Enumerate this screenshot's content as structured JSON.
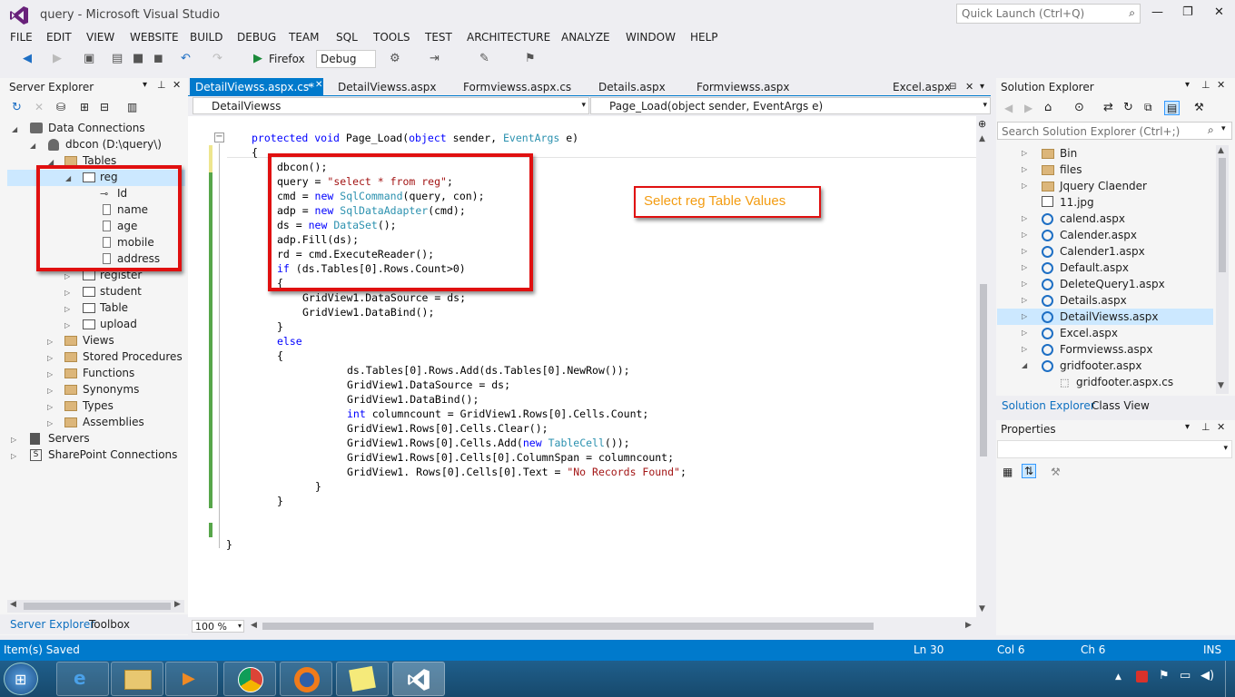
{
  "window": {
    "title": "query - Microsoft Visual Studio",
    "quick_launch_placeholder": "Quick Launch (Ctrl+Q)",
    "minimize": "—",
    "restore": "❐",
    "close": "✕"
  },
  "menu": [
    "FILE",
    "EDIT",
    "VIEW",
    "WEBSITE",
    "BUILD",
    "DEBUG",
    "TEAM",
    "SQL",
    "TOOLS",
    "TEST",
    "ARCHITECTURE",
    "ANALYZE",
    "WINDOW",
    "HELP"
  ],
  "toolbar": {
    "browser": "Firefox",
    "config": "Debug"
  },
  "server_explorer": {
    "title": "Server Explorer",
    "tree": [
      {
        "label": "Data Connections"
      },
      {
        "label": "dbcon (D:\\query\\)"
      },
      {
        "label": "Tables"
      },
      {
        "label": "reg"
      },
      {
        "label": "Id"
      },
      {
        "label": "name"
      },
      {
        "label": "age"
      },
      {
        "label": "mobile"
      },
      {
        "label": "address"
      },
      {
        "label": "register"
      },
      {
        "label": "student"
      },
      {
        "label": "Table"
      },
      {
        "label": "upload"
      },
      {
        "label": "Views"
      },
      {
        "label": "Stored Procedures"
      },
      {
        "label": "Functions"
      },
      {
        "label": "Synonyms"
      },
      {
        "label": "Types"
      },
      {
        "label": "Assemblies"
      },
      {
        "label": "Servers"
      },
      {
        "label": "SharePoint Connections"
      }
    ],
    "tabs": [
      "Server Explorer",
      "Toolbox"
    ]
  },
  "editor": {
    "tabs": [
      "DetailViewss.aspx.cs*",
      "DetailViewss.aspx",
      "Formviewss.aspx.cs",
      "Details.aspx",
      "Formviewss.aspx",
      "Excel.aspx"
    ],
    "nav_left": "DetailViewss",
    "nav_right": "Page_Load(object sender, EventArgs e)",
    "zoom": "100 %",
    "callout": "Select  reg Table Values"
  },
  "solution_explorer": {
    "title": "Solution Explorer",
    "search_placeholder": "Search Solution Explorer (Ctrl+;)",
    "items": [
      "Bin",
      "files",
      "Jquery Claender",
      "11.jpg",
      "calend.aspx",
      "Calender.aspx",
      "Calender1.aspx",
      "Default.aspx",
      "DeleteQuery1.aspx",
      "Details.aspx",
      "DetailViewss.aspx",
      "Excel.aspx",
      "Formviewss.aspx",
      "gridfooter.aspx",
      "gridfooter.aspx.cs"
    ],
    "tabs": [
      "Solution Explorer",
      "Class View"
    ]
  },
  "properties": {
    "title": "Properties"
  },
  "status": {
    "message": "Item(s) Saved",
    "ln": "Ln 30",
    "col": "Col 6",
    "ch": "Ch 6",
    "ins": "INS"
  }
}
